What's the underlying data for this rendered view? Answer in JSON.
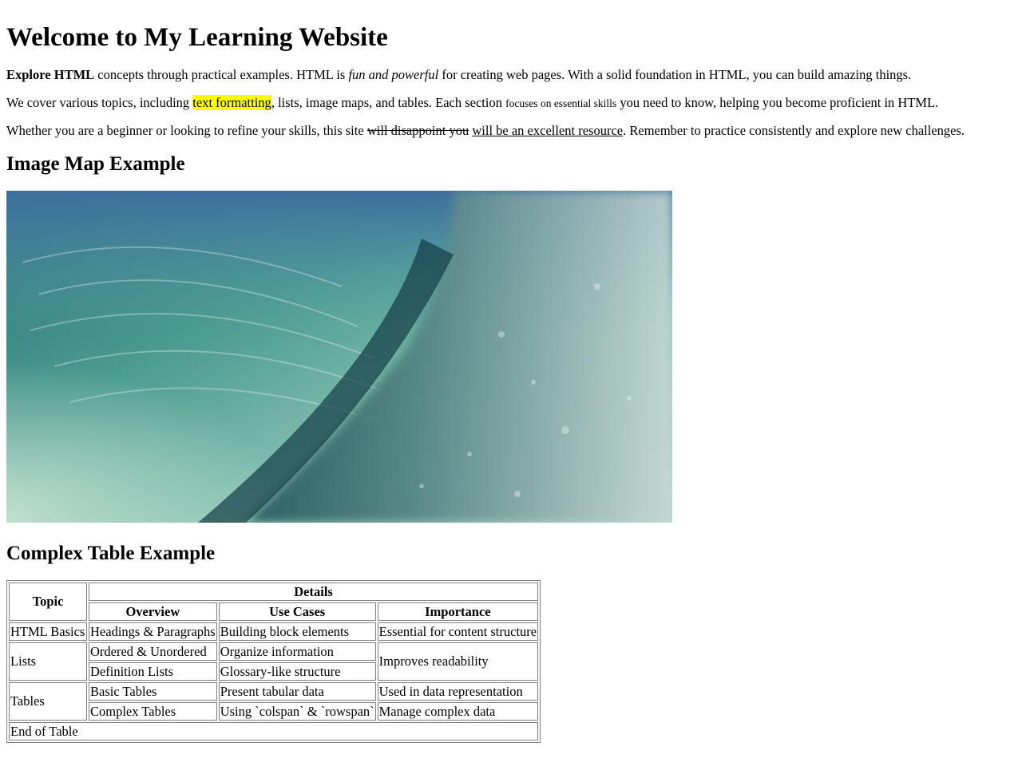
{
  "title": "Welcome to My Learning Website",
  "intro": {
    "p1": {
      "bold": "Explore HTML",
      "text1": " concepts through practical examples. HTML is ",
      "italic": "fun and powerful",
      "text2": " for creating web pages. With a solid foundation in HTML, you can build amazing things."
    },
    "p2": {
      "text1": "We cover various topics, including ",
      "highlight": "text formatting",
      "text2": ", lists, image maps, and tables. Each section ",
      "small": "focuses on essential skills",
      "text3": " you need to know, helping you become proficient in HTML."
    },
    "p3": {
      "text1": "Whether you are a beginner or looking to refine your skills, this site ",
      "deleted": "will disappoint you",
      "text2": " ",
      "inserted": "will be an excellent resource",
      "text3": ". Remember to practice consistently and explore new challenges."
    }
  },
  "image_map": {
    "heading": "Image Map Example"
  },
  "table_section": {
    "heading": "Complex Table Example",
    "header": {
      "topic": "Topic",
      "details": "Details",
      "overview": "Overview",
      "use_cases": "Use Cases",
      "importance": "Importance"
    },
    "rows": {
      "html_basics": {
        "topic": "HTML Basics",
        "overview": "Headings & Paragraphs",
        "use_case": "Building block elements",
        "importance": "Essential for content structure"
      },
      "lists": {
        "topic": "Lists",
        "overview1": "Ordered & Unordered",
        "use_case1": "Organize information",
        "importance": "Improves readability",
        "overview2": "Definition Lists",
        "use_case2": "Glossary-like structure"
      },
      "tables": {
        "topic": "Tables",
        "overview1": "Basic Tables",
        "use_case1": "Present tabular data",
        "importance1": "Used in data representation",
        "overview2": "Complex Tables",
        "use_case2": "Using `colspan` & `rowspan`",
        "importance2": "Manage complex data"
      }
    },
    "footer": "End of Table"
  }
}
